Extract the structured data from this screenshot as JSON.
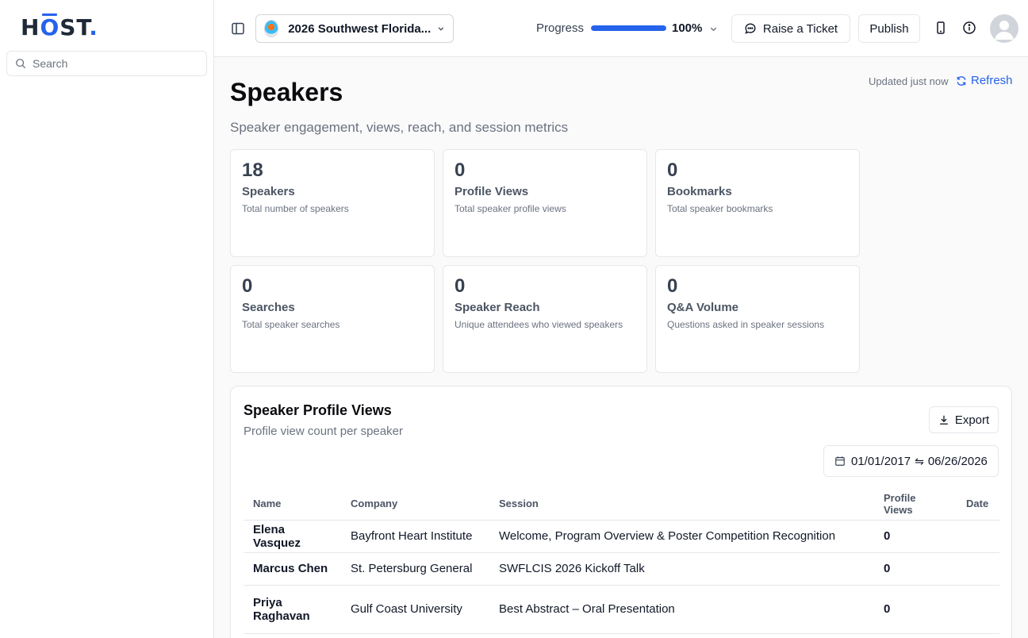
{
  "sidebar": {
    "logo": {
      "h": "H",
      "o": "O",
      "st": "ST",
      "dot": "."
    },
    "search_placeholder": "Search"
  },
  "topbar": {
    "event_name": "2026 Southwest Florida...",
    "progress_label": "Progress",
    "progress_value": "100%",
    "progress_fraction": 1.0,
    "raise_ticket": "Raise a Ticket",
    "publish": "Publish"
  },
  "page": {
    "title": "Speakers",
    "subtitle": "Speaker engagement, views, reach, and session metrics",
    "updated": "Updated just now",
    "refresh": "Refresh"
  },
  "metrics": [
    {
      "value": "18",
      "label": "Speakers",
      "desc": "Total number of speakers"
    },
    {
      "value": "0",
      "label": "Profile Views",
      "desc": "Total speaker profile views"
    },
    {
      "value": "0",
      "label": "Bookmarks",
      "desc": "Total speaker bookmarks"
    },
    {
      "value": "0",
      "label": "Searches",
      "desc": "Total speaker searches"
    },
    {
      "value": "0",
      "label": "Speaker Reach",
      "desc": "Unique attendees who viewed speakers"
    },
    {
      "value": "0",
      "label": "Q&A Volume",
      "desc": "Questions asked in speaker sessions"
    }
  ],
  "table_card": {
    "title": "Speaker Profile Views",
    "subtitle": "Profile view count per speaker",
    "export": "Export",
    "date_from": "01/01/2017",
    "date_to": "06/26/2026",
    "columns": [
      "Name",
      "Company",
      "Session",
      "Profile Views",
      "Date"
    ],
    "rows": [
      {
        "name": "Elena Vasquez",
        "company": "Bayfront Heart Institute",
        "session": "Welcome, Program Overview & Poster Competition Recognition",
        "views": "0",
        "date": ""
      },
      {
        "name": "Marcus Chen",
        "company": "St. Petersburg General",
        "session": "SWFLCIS 2026 Kickoff Talk",
        "views": "0",
        "date": ""
      },
      {
        "name_line1": "Priya",
        "name_line2": "Raghavan",
        "company": "Gulf Coast University",
        "session": "Best Abstract – Oral Presentation",
        "views": "0",
        "date": ""
      }
    ]
  },
  "colors": {
    "accent": "#2563eb",
    "border": "#e5e7eb",
    "muted": "#6b7280"
  },
  "icons": [
    "search-icon",
    "panel-toggle-icon",
    "chevron-down-icon",
    "chat-bubble-icon",
    "phone-icon",
    "info-icon",
    "user-avatar-icon",
    "refresh-icon",
    "download-icon",
    "calendar-icon",
    "swap-icon"
  ]
}
